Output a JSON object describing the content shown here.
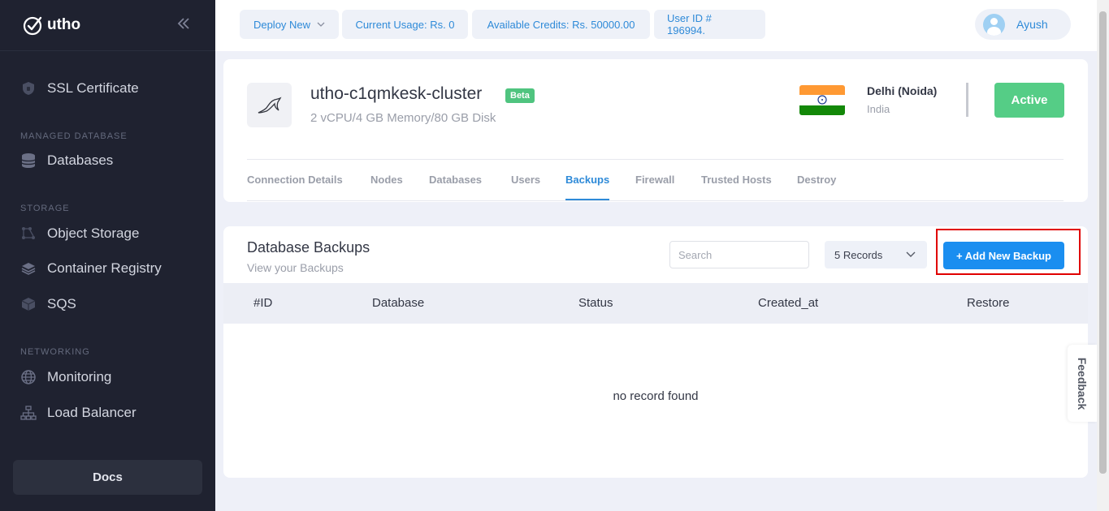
{
  "brand": {
    "name": "utho"
  },
  "sidebar": {
    "items": [
      {
        "label": "SSL Certificate",
        "icon": "shield-icon"
      },
      {
        "section": "MANAGED DATABASE"
      },
      {
        "label": "Databases",
        "icon": "database-icon"
      },
      {
        "section": "STORAGE"
      },
      {
        "label": "Object Storage",
        "icon": "object-storage-icon"
      },
      {
        "label": "Container Registry",
        "icon": "layers-icon"
      },
      {
        "label": "SQS",
        "icon": "stack-icon"
      },
      {
        "section": "NETWORKING"
      },
      {
        "label": "Monitoring",
        "icon": "globe-icon"
      },
      {
        "label": "Load Balancer",
        "icon": "network-icon"
      }
    ],
    "docs_label": "Docs"
  },
  "topbar": {
    "deploy_label": "Deploy New",
    "usage_label": "Current Usage: Rs. 0",
    "credits_label": "Available Credits: Rs. 50000.00",
    "userid_label": "User ID # 196994.",
    "username": "Ayush"
  },
  "cluster": {
    "name": "utho-c1qmkesk-cluster",
    "badge": "Beta",
    "spec": "2 vCPU/4 GB Memory/80 GB Disk",
    "city": "Delhi (Noida)",
    "country": "India",
    "status": "Active",
    "flag_colors": [
      "#ff9933",
      "#ffffff",
      "#138808"
    ]
  },
  "tabs": [
    {
      "label": "Connection Details"
    },
    {
      "label": "Nodes"
    },
    {
      "label": "Databases"
    },
    {
      "label": "Users"
    },
    {
      "label": "Backups",
      "active": true
    },
    {
      "label": "Firewall"
    },
    {
      "label": "Trusted Hosts"
    },
    {
      "label": "Destroy"
    }
  ],
  "backups": {
    "title": "Database Backups",
    "subtitle": "View your Backups",
    "search_placeholder": "Search",
    "records_selected": "5 Records",
    "add_label": "+ Add New Backup",
    "columns": [
      "#ID",
      "Database",
      "Status",
      "Created_at",
      "Restore"
    ],
    "empty_message": "no record found"
  },
  "feedback_label": "Feedback",
  "colors": {
    "accent": "#1a8ef0",
    "active_green": "#55cd86",
    "sidebar_bg": "#1f2230"
  }
}
